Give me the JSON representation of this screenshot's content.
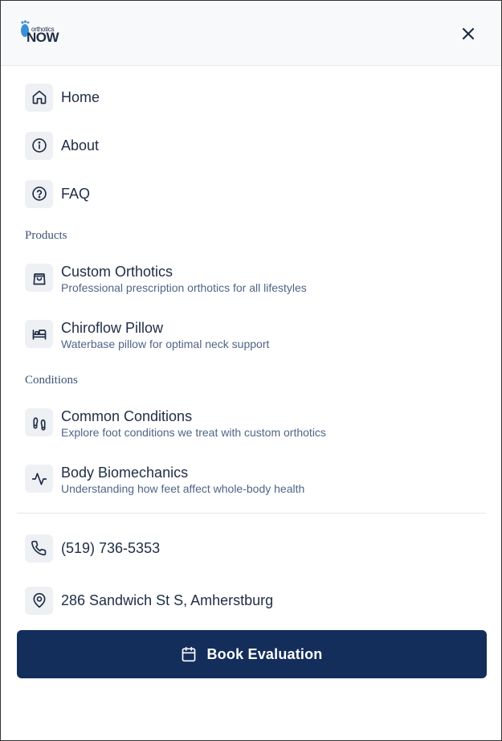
{
  "brand": {
    "logo_small": "orthotics",
    "logo_big": "NOW"
  },
  "nav": [
    {
      "label": "Home",
      "icon": "home-icon"
    },
    {
      "label": "About",
      "icon": "info-icon"
    },
    {
      "label": "FAQ",
      "icon": "help-circle-icon"
    }
  ],
  "sections": {
    "products": "Products",
    "conditions": "Conditions"
  },
  "products": [
    {
      "title": "Custom Orthotics",
      "desc": "Professional prescription orthotics for all lifestyles",
      "icon": "shopping-bag-icon"
    },
    {
      "title": "Chiroflow Pillow",
      "desc": "Waterbase pillow for optimal neck support",
      "icon": "bed-icon"
    }
  ],
  "conditions": [
    {
      "title": "Common Conditions",
      "desc": "Explore foot conditions we treat with custom orthotics",
      "icon": "footprints-icon"
    },
    {
      "title": "Body Biomechanics",
      "desc": "Understanding how feet affect whole-body health",
      "icon": "activity-icon"
    }
  ],
  "contact": {
    "phone": "(519) 736-5353",
    "address": "286 Sandwich St S, Amherstburg"
  },
  "cta": {
    "label": "Book Evaluation",
    "icon": "calendar-icon"
  },
  "colors": {
    "primary": "#142e5c",
    "text": "#1f2d44",
    "muted": "#4f6587",
    "icon_bg": "#eef0f4",
    "logo_blue": "#3b8fd9"
  }
}
